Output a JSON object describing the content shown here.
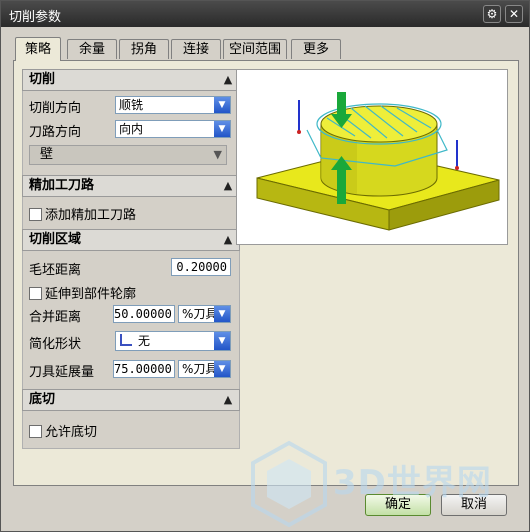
{
  "window": {
    "title": "切削参数"
  },
  "tabs": [
    {
      "label": "策略",
      "active": true
    },
    {
      "label": "余量",
      "active": false
    },
    {
      "label": "拐角",
      "active": false
    },
    {
      "label": "连接",
      "active": false
    },
    {
      "label": "空间范围",
      "active": false
    },
    {
      "label": "更多",
      "active": false
    }
  ],
  "cutting": {
    "header": "切削",
    "direction_label": "切削方向",
    "direction_value": "顺铣",
    "path_label": "刀路方向",
    "path_value": "向内",
    "wall_label": "壁"
  },
  "finish": {
    "header": "精加工刀路",
    "add_pass_label": "添加精加工刀路",
    "add_pass_checked": false
  },
  "region": {
    "header": "切削区域",
    "blank_distance_label": "毛坯距离",
    "blank_distance_value": "0.20000",
    "extend_label": "延伸到部件轮廓",
    "extend_checked": false,
    "merge_distance_label": "合并距离",
    "merge_distance_value": "50.00000",
    "merge_unit": "%刀具",
    "simplify_label": "简化形状",
    "simplify_value": "无",
    "tool_extension_label": "刀具延展量",
    "tool_extension_value": "75.00000",
    "tool_extension_unit": "%刀具"
  },
  "undercut": {
    "header": "底切",
    "allow_label": "允许底切",
    "allow_checked": false
  },
  "buttons": {
    "ok": "确定",
    "cancel": "取消"
  },
  "watermark": {
    "text": "3D世界网"
  },
  "colors": {
    "base": "#e3e31a",
    "cylinder": "#d9dc24",
    "arrow": "#1aa83a",
    "path": "#3fb8c8",
    "combo_arrow": "#2255c8"
  }
}
